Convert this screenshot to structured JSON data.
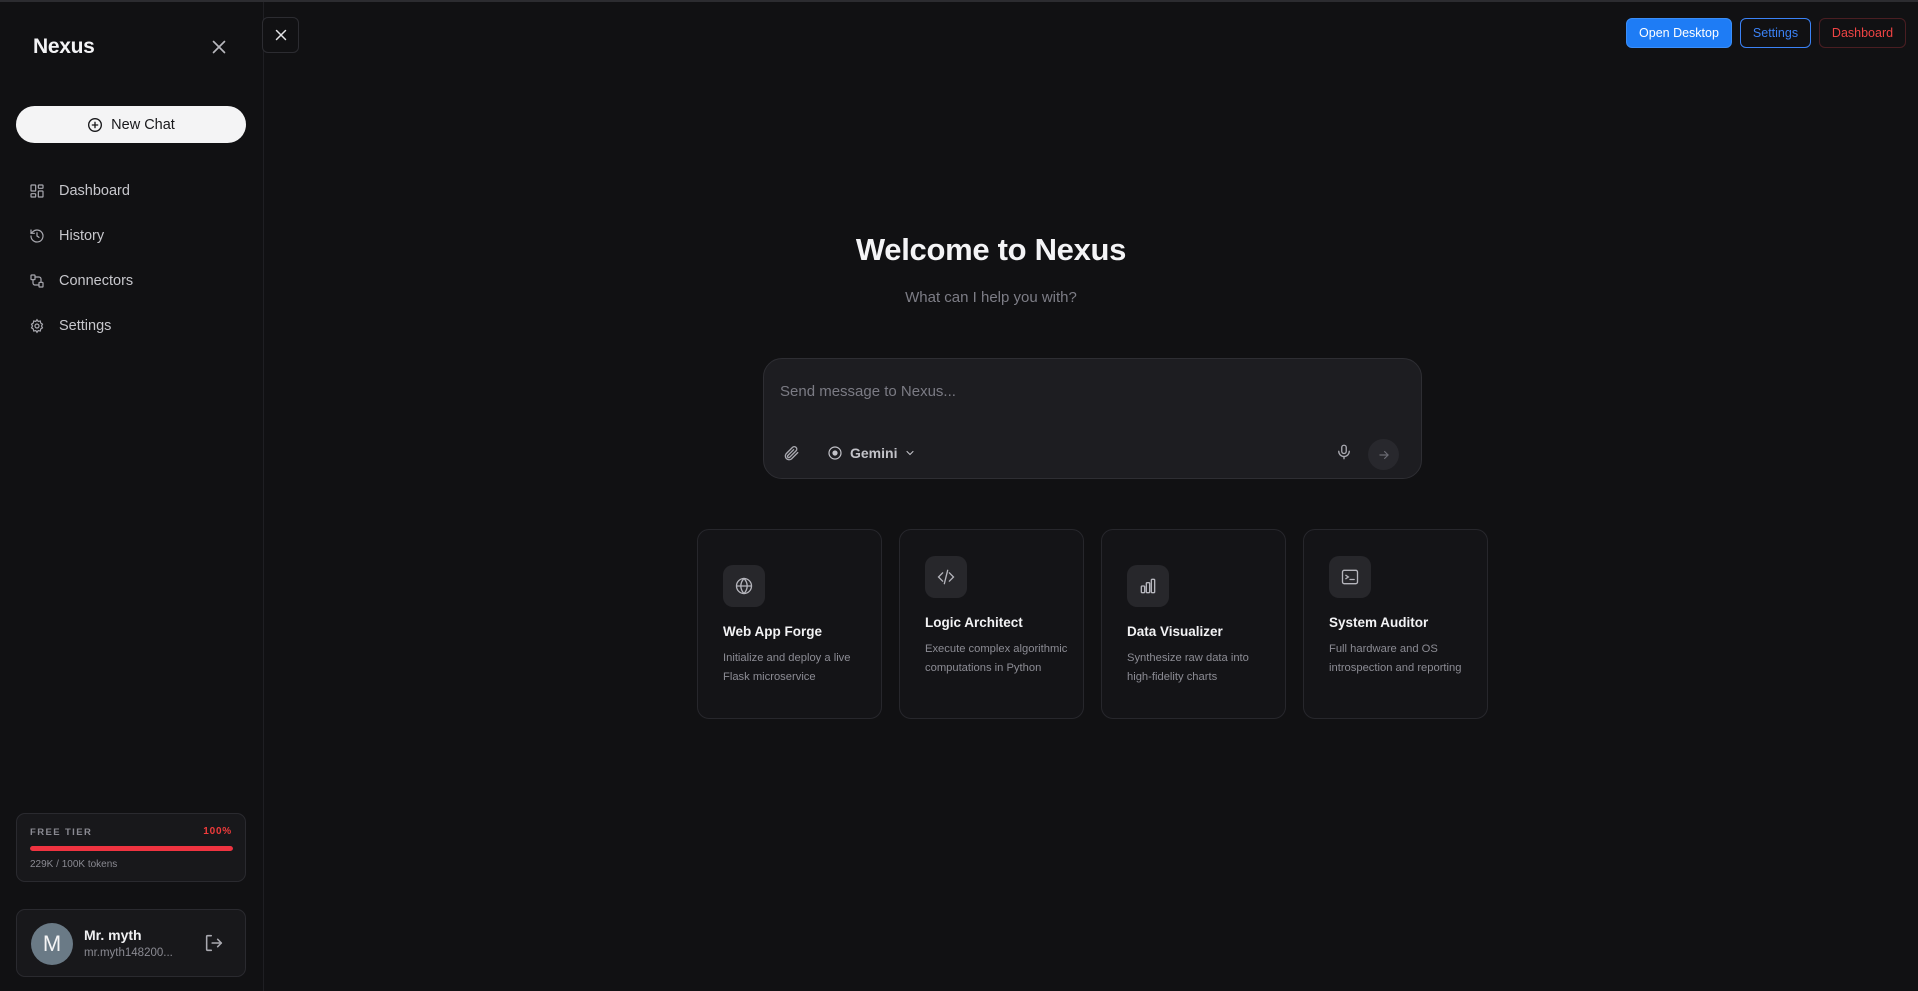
{
  "sidebar": {
    "brand": "Nexus",
    "new_chat_label": "New Chat",
    "nav": [
      {
        "label": "Dashboard",
        "icon": "dashboard-icon"
      },
      {
        "label": "History",
        "icon": "history-icon"
      },
      {
        "label": "Connectors",
        "icon": "connectors-icon"
      },
      {
        "label": "Settings",
        "icon": "gear-icon"
      }
    ],
    "tier": {
      "label": "FREE TIER",
      "percent_label": "100%",
      "usage_fraction": 1.0,
      "tokens_text": "229K / 100K tokens",
      "bar_color": "#ef3340"
    },
    "profile": {
      "initial": "M",
      "name": "Mr. myth",
      "email": "mr.myth148200..."
    }
  },
  "header": {
    "open_desktop_label": "Open Desktop",
    "settings_label": "Settings",
    "dashboard_label": "Dashboard"
  },
  "main": {
    "title": "Welcome to Nexus",
    "subtitle": "What can I help you with?",
    "composer": {
      "placeholder": "Send message to Nexus...",
      "model": "Gemini"
    },
    "cards": [
      {
        "title": "Web App Forge",
        "description": "Initialize and deploy a live Flask microservice",
        "icon": "globe-icon"
      },
      {
        "title": "Logic Architect",
        "description": "Execute complex algorithmic computations in Python",
        "icon": "code-icon"
      },
      {
        "title": "Data Visualizer",
        "description": "Synthesize raw data into high-fidelity charts",
        "icon": "bar-chart-icon"
      },
      {
        "title": "System Auditor",
        "description": "Full hardware and OS introspection and reporting",
        "icon": "terminal-icon"
      }
    ]
  },
  "colors": {
    "background": "#111113",
    "accent_blue": "#1e7cf5",
    "danger_red": "#ef4444"
  }
}
